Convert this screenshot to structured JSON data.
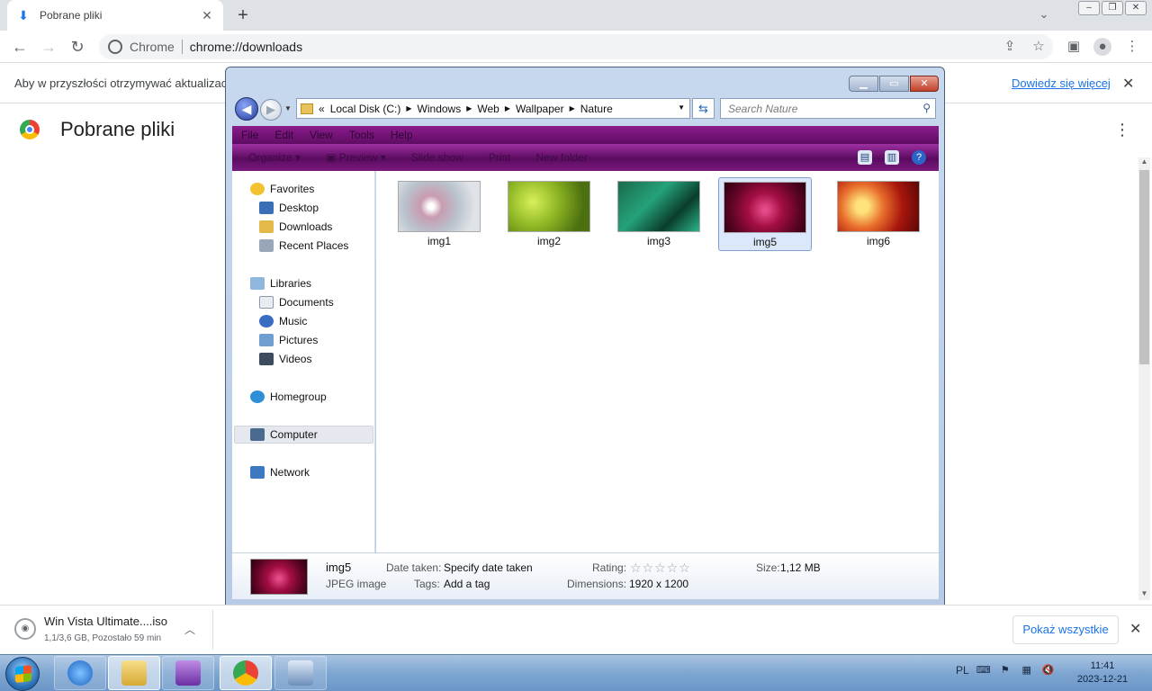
{
  "browser": {
    "tab_title": "Pobrane pliki",
    "omnibox_label": "Chrome",
    "url": "chrome://downloads"
  },
  "infobar": {
    "message": "Aby w przyszłości otrzymywać aktualizacje",
    "link": "Dowiedz się więcej"
  },
  "page": {
    "title": "Pobrane pliki"
  },
  "explorer": {
    "breadcrumbs": [
      "Local Disk (C:)",
      "Windows",
      "Web",
      "Wallpaper",
      "Nature"
    ],
    "search_placeholder": "Search Nature",
    "menu": [
      "File",
      "Edit",
      "View",
      "Tools",
      "Help"
    ],
    "commands": [
      "Organize",
      "Preview",
      "Slide show",
      "Print",
      "New folder"
    ],
    "nav": {
      "favorites": "Favorites",
      "desktop": "Desktop",
      "downloads": "Downloads",
      "recent": "Recent Places",
      "libraries": "Libraries",
      "documents": "Documents",
      "music": "Music",
      "pictures": "Pictures",
      "videos": "Videos",
      "homegroup": "Homegroup",
      "computer": "Computer",
      "network": "Network"
    },
    "files": [
      {
        "name": "img1"
      },
      {
        "name": "img2"
      },
      {
        "name": "img3"
      },
      {
        "name": "img5"
      },
      {
        "name": "img6"
      }
    ],
    "details": {
      "name": "img5",
      "type": "JPEG image",
      "date_label": "Date taken:",
      "date_value": "Specify date taken",
      "tags_label": "Tags:",
      "tags_value": "Add a tag",
      "rating_label": "Rating:",
      "dimensions_label": "Dimensions:",
      "dimensions_value": "1920 x 1200",
      "size_label": "Size:",
      "size_value": "1,12 MB"
    }
  },
  "download_shelf": {
    "file_name": "Win Vista Ultimate....iso",
    "status": "1,1/3,6 GB, Pozostało 59 min",
    "show_all": "Pokaż wszystkie"
  },
  "taskbar": {
    "language": "PL",
    "time": "11:41",
    "date": "2023-12-21"
  }
}
